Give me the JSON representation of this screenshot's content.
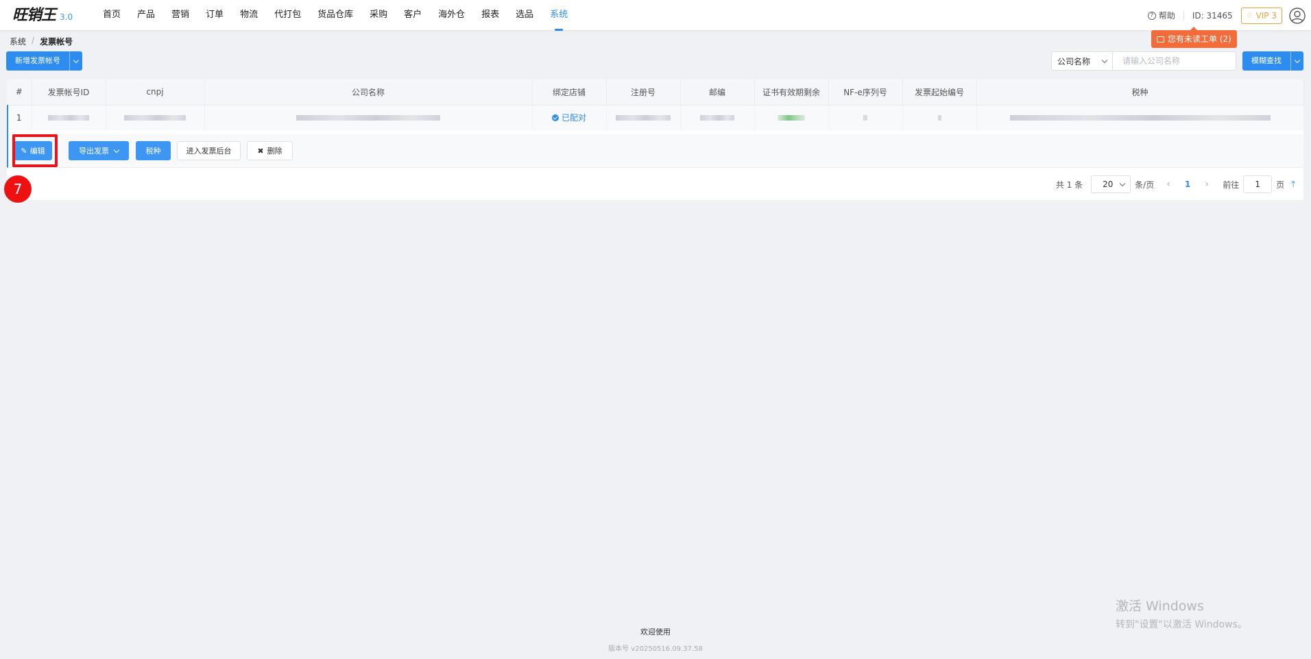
{
  "header": {
    "logo_text": "旺销王",
    "logo_version": "3.0",
    "nav": [
      "首页",
      "产品",
      "营销",
      "订单",
      "物流",
      "代打包",
      "货品仓库",
      "采购",
      "客户",
      "海外仓",
      "报表",
      "选品",
      "系统"
    ],
    "active_nav": "系统",
    "help": "帮助",
    "user_id": "ID: 31465",
    "vip": "VIP 3",
    "ticket_notice": "您有未读工单 (2)"
  },
  "breadcrumb": [
    "系统",
    "发票帐号"
  ],
  "toolbar": {
    "add_button": "新增发票帐号",
    "search_field": "公司名称",
    "search_placeholder": "请输入公司名称",
    "search_button": "模糊查找"
  },
  "table": {
    "columns": [
      "#",
      "发票帐号ID",
      "cnpj",
      "公司名称",
      "绑定店铺",
      "注册号",
      "邮编",
      "证书有效期剩余",
      "NF-e序列号",
      "发票起始编号",
      "税种"
    ],
    "rows": [
      {
        "index": "1",
        "bind_status": "已配对"
      }
    ]
  },
  "row_actions": {
    "edit": "编辑",
    "export": "导出发票",
    "tax": "税种",
    "backend": "进入发票后台",
    "delete": "删除"
  },
  "pagination": {
    "total": "共 1 条",
    "page_size": "20",
    "per_page_suffix": "条/页",
    "current_page": "1",
    "goto_label": "前往",
    "goto_value": "1",
    "page_suffix": "页"
  },
  "annotation": {
    "step": "7"
  },
  "watermark": {
    "line1": "激活 Windows",
    "line2": "转到\"设置\"以激活 Windows。"
  },
  "footer": {
    "welcome": "欢迎使用",
    "version": "版本号 v20250516.09.37.58"
  },
  "colors": {
    "primary": "#2d8cf0",
    "ticket": "#f26b3a",
    "vip": "#e6a23c",
    "highlight": "#e8141b"
  }
}
